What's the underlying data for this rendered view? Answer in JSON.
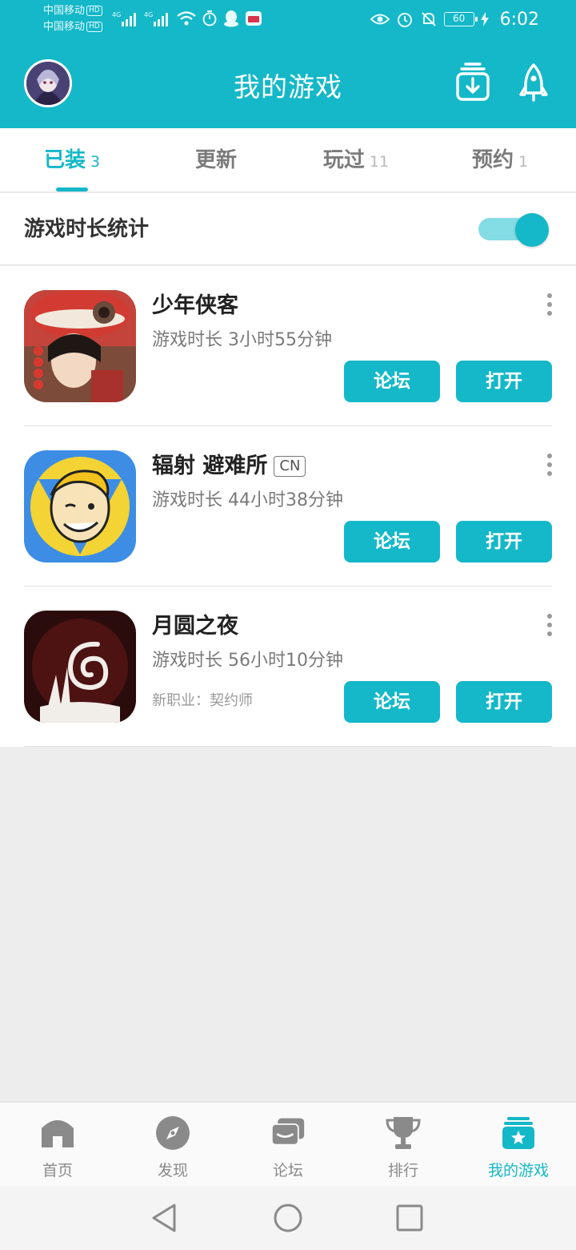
{
  "status_bar": {
    "carrier_1": "中国移动",
    "carrier_2": "中国移动",
    "hd": "HD",
    "network": "4G",
    "battery": "60",
    "time": "6:02"
  },
  "header": {
    "title": "我的游戏"
  },
  "tabs": [
    {
      "label": "已装",
      "count": "3"
    },
    {
      "label": "更新",
      "count": ""
    },
    {
      "label": "玩过",
      "count": "11"
    },
    {
      "label": "预约",
      "count": "1"
    }
  ],
  "stats": {
    "label": "游戏时长统计",
    "toggle_on": true
  },
  "games": [
    {
      "name": "少年侠客",
      "badge": "",
      "time": "游戏时长 3小时55分钟",
      "note": "",
      "forum_label": "论坛",
      "open_label": "打开"
    },
    {
      "name": "辐射 避难所",
      "badge": "CN",
      "time": "游戏时长 44小时38分钟",
      "note": "",
      "forum_label": "论坛",
      "open_label": "打开"
    },
    {
      "name": "月圆之夜",
      "badge": "",
      "time": "游戏时长 56小时10分钟",
      "note": "新职业：契约师",
      "forum_label": "论坛",
      "open_label": "打开"
    }
  ],
  "bottom_nav": [
    {
      "label": "首页",
      "icon": "home-icon"
    },
    {
      "label": "发现",
      "icon": "compass-icon"
    },
    {
      "label": "论坛",
      "icon": "forum-icon"
    },
    {
      "label": "排行",
      "icon": "trophy-icon"
    },
    {
      "label": "我的游戏",
      "icon": "my-games-icon"
    }
  ],
  "colors": {
    "accent": "#14b8c8",
    "background": "#ededed"
  }
}
